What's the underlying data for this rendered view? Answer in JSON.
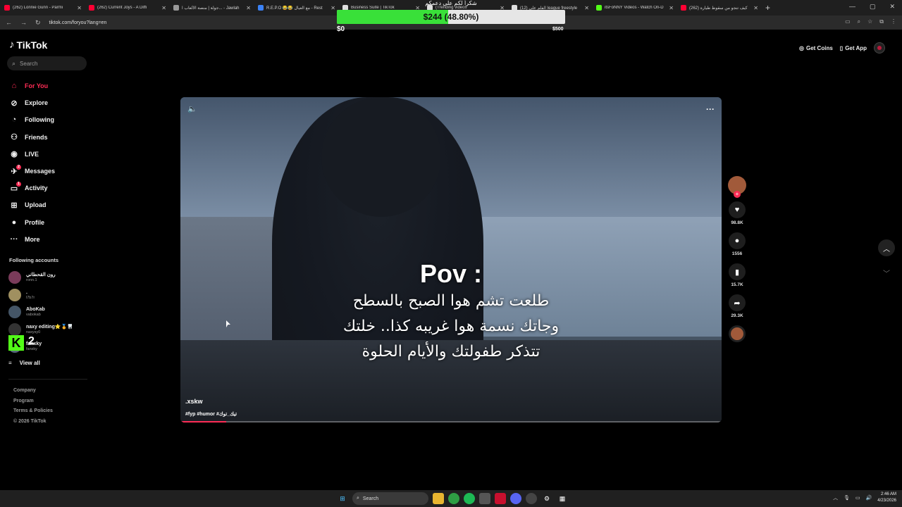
{
  "browser": {
    "tabs": [
      {
        "title": "(262) Lonnie Gunn - Parmi",
        "color": "#ff0033"
      },
      {
        "title": "(262) Current Joys - A Diffi",
        "color": "#ff0033"
      },
      {
        "title": "جولة | منصة الألعاب ا... - Jawlah",
        "color": "#999999"
      },
      {
        "title": "R.E.P.O 😂😂 مع العيال - Rest",
        "color": "#3b82f6"
      },
      {
        "title": "Business Suite | TikTok",
        "color": "#dddddd"
      },
      {
        "title": "(Trending videos",
        "color": "#dddddd"
      },
      {
        "title": "(12) الفلم علي league freestyle",
        "color": "#dddddd"
      },
      {
        "title": "itsFoNNY Videos - Watch On-D",
        "color": "#53fc18"
      },
      {
        "title": "(262) كيف تنجو من سقوط طيارة",
        "color": "#ff0033"
      }
    ],
    "new_tab": "+",
    "url": "tiktok.com/foryou?lang=en",
    "window_controls": [
      "—",
      "▢",
      "✕"
    ]
  },
  "donation": {
    "title": "شكراً لكم على دعمكم",
    "amount_text": "$244 (48.80%)",
    "progress": 0.488,
    "min_label": "$0",
    "max_label": "$500",
    "fill_color": "#39e039"
  },
  "tiktok": {
    "logo": "TikTok",
    "search_placeholder": "Search",
    "menu": [
      {
        "label": "For You",
        "icon": "home-icon",
        "glyph": "⌂",
        "active": true
      },
      {
        "label": "Explore",
        "icon": "compass-icon",
        "glyph": "⊘"
      },
      {
        "label": "Following",
        "icon": "following-icon",
        "glyph": "◔"
      },
      {
        "label": "Friends",
        "icon": "friends-icon",
        "glyph": "⚇"
      },
      {
        "label": "LIVE",
        "icon": "live-icon",
        "glyph": "◉"
      },
      {
        "label": "Messages",
        "icon": "messages-icon",
        "glyph": "✈",
        "badge": "2"
      },
      {
        "label": "Activity",
        "icon": "activity-icon",
        "glyph": "▭",
        "badge": "1"
      },
      {
        "label": "Upload",
        "icon": "upload-icon",
        "glyph": "⊞"
      },
      {
        "label": "Profile",
        "icon": "profile-icon",
        "glyph": "●"
      },
      {
        "label": "More",
        "icon": "more-icon",
        "glyph": "···"
      }
    ],
    "following_title": "Following accounts",
    "following_accounts": [
      {
        "name": "رون القحطاني",
        "handle": "ronn.1",
        "color": "#7a3b5a"
      },
      {
        "name": ".",
        "handle": "l7b7r",
        "color": "#a09060"
      },
      {
        "name": "AboKab",
        "handle": "vabokab",
        "color": "#445566"
      },
      {
        "name": "naxy editing⭐🏅🦷",
        "handle": "naxysy0",
        "color": "#333333"
      },
      {
        "name": "fanxky",
        "handle": "fanxky",
        "color": "#556677"
      }
    ],
    "kick_overlay": {
      "logo": "K",
      "count": "2"
    },
    "view_all": "View all",
    "footer": [
      "Company",
      "Program",
      "Terms & Policies",
      "© 2026 TikTok"
    ],
    "top_right": {
      "get_coins": "Get Coins",
      "get_app": "Get App"
    }
  },
  "video": {
    "caption_title": "Pov :",
    "caption_lines": [
      "طلعت تشم هوا الصبح بالسطح",
      "وجاتك نسمة هوا غريبه كذا.. خلتك",
      "تتذكر طفولتك والأيام الحلوة"
    ],
    "author": ".xskw",
    "tags": "#fyp #humor #تيك_توك",
    "progress": 0.085,
    "actions": [
      {
        "icon": "heart-icon",
        "glyph": "♥",
        "count": "98.8K"
      },
      {
        "icon": "comment-icon",
        "glyph": "●",
        "count": "1556"
      },
      {
        "icon": "bookmark-icon",
        "glyph": "▮",
        "count": "15.7K"
      },
      {
        "icon": "share-icon",
        "glyph": "➦",
        "count": "29.3K"
      }
    ]
  },
  "taskbar": {
    "search": "Search",
    "time": "2:46 AM",
    "date": "4/23/2026"
  }
}
